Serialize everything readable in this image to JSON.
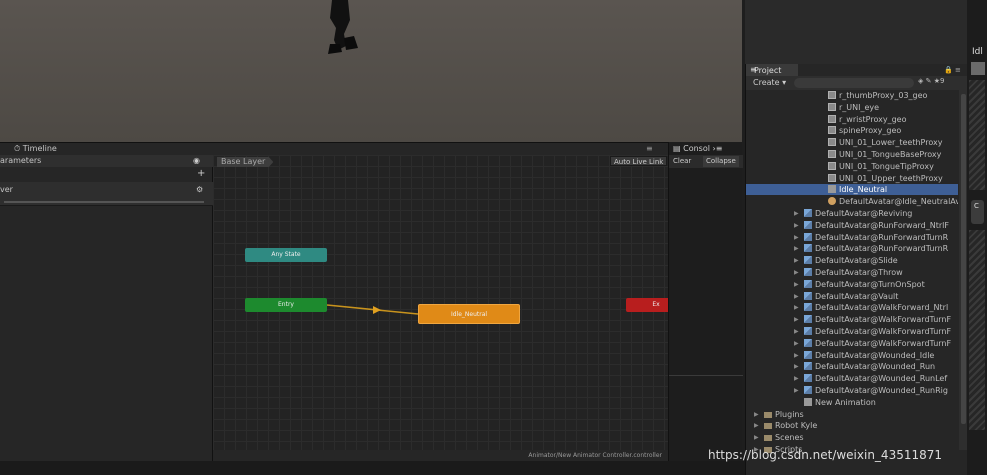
{
  "timeline_tab": "Timeline",
  "animator_tab_menu": "≡",
  "params": {
    "header": "arameters",
    "layer_name": "ver"
  },
  "graph": {
    "breadcrumb": "Base Layer",
    "auto_live_link": "Auto Live Link",
    "nodes": {
      "any_state": "Any State",
      "entry": "Entry",
      "idle": "Idle_Neutral",
      "exit": "Ex"
    },
    "footer_path": "Animator/New Animator Controller.controller"
  },
  "console": {
    "tab": "Consol",
    "clear": "Clear",
    "collapse": "Collapse"
  },
  "project": {
    "tab": "Project",
    "create": "Create ▾",
    "items": [
      {
        "label": "r_thumbProxy_03_geo",
        "icon": "mesh",
        "indent": 2,
        "arrow": false
      },
      {
        "label": "r_UNI_eye",
        "icon": "mesh",
        "indent": 2,
        "arrow": false
      },
      {
        "label": "r_wristProxy_geo",
        "icon": "mesh",
        "indent": 2,
        "arrow": false
      },
      {
        "label": "spineProxy_geo",
        "icon": "mesh",
        "indent": 2,
        "arrow": false
      },
      {
        "label": "UNI_01_Lower_teethProxy",
        "icon": "mesh",
        "indent": 2,
        "arrow": false
      },
      {
        "label": "UNI_01_TongueBaseProxy",
        "icon": "mesh",
        "indent": 2,
        "arrow": false
      },
      {
        "label": "UNI_01_TongueTipProxy",
        "icon": "mesh",
        "indent": 2,
        "arrow": false
      },
      {
        "label": "UNI_01_Upper_teethProxy",
        "icon": "mesh",
        "indent": 2,
        "arrow": false
      },
      {
        "label": "Idle_Neutral",
        "icon": "anim",
        "indent": 2,
        "arrow": false,
        "selected": true
      },
      {
        "label": "DefaultAvatar@Idle_NeutralAva",
        "icon": "controller",
        "indent": 2,
        "arrow": false
      },
      {
        "label": "DefaultAvatar@Reviving",
        "icon": "model",
        "indent": 1,
        "arrow": true
      },
      {
        "label": "DefaultAvatar@RunForward_NtrlF",
        "icon": "model",
        "indent": 1,
        "arrow": true
      },
      {
        "label": "DefaultAvatar@RunForwardTurnR",
        "icon": "model",
        "indent": 1,
        "arrow": true
      },
      {
        "label": "DefaultAvatar@RunForwardTurnR",
        "icon": "model",
        "indent": 1,
        "arrow": true
      },
      {
        "label": "DefaultAvatar@Slide",
        "icon": "model",
        "indent": 1,
        "arrow": true
      },
      {
        "label": "DefaultAvatar@Throw",
        "icon": "model",
        "indent": 1,
        "arrow": true
      },
      {
        "label": "DefaultAvatar@TurnOnSpot",
        "icon": "model",
        "indent": 1,
        "arrow": true
      },
      {
        "label": "DefaultAvatar@Vault",
        "icon": "model",
        "indent": 1,
        "arrow": true
      },
      {
        "label": "DefaultAvatar@WalkForward_Ntrl",
        "icon": "model",
        "indent": 1,
        "arrow": true
      },
      {
        "label": "DefaultAvatar@WalkForwardTurnF",
        "icon": "model",
        "indent": 1,
        "arrow": true
      },
      {
        "label": "DefaultAvatar@WalkForwardTurnF",
        "icon": "model",
        "indent": 1,
        "arrow": true
      },
      {
        "label": "DefaultAvatar@WalkForwardTurnF",
        "icon": "model",
        "indent": 1,
        "arrow": true
      },
      {
        "label": "DefaultAvatar@Wounded_Idle",
        "icon": "model",
        "indent": 1,
        "arrow": true
      },
      {
        "label": "DefaultAvatar@Wounded_Run",
        "icon": "model",
        "indent": 1,
        "arrow": true
      },
      {
        "label": "DefaultAvatar@Wounded_RunLef",
        "icon": "model",
        "indent": 1,
        "arrow": true
      },
      {
        "label": "DefaultAvatar@Wounded_RunRig",
        "icon": "model",
        "indent": 1,
        "arrow": true
      },
      {
        "label": "New Animation",
        "icon": "anim",
        "indent": 1,
        "arrow": false
      },
      {
        "label": "Plugins",
        "icon": "folder",
        "indent": 0,
        "arrow": true
      },
      {
        "label": "Robot Kyle",
        "icon": "folder",
        "indent": 0,
        "arrow": true
      },
      {
        "label": "Scenes",
        "icon": "folder",
        "indent": 0,
        "arrow": true
      },
      {
        "label": "Scripts",
        "icon": "folder",
        "indent": 0,
        "arrow": true
      }
    ]
  },
  "right_edge": {
    "label": "Idl",
    "pill_label": "C"
  },
  "watermark": "https://blog.csdn.net/weixin_43511871"
}
